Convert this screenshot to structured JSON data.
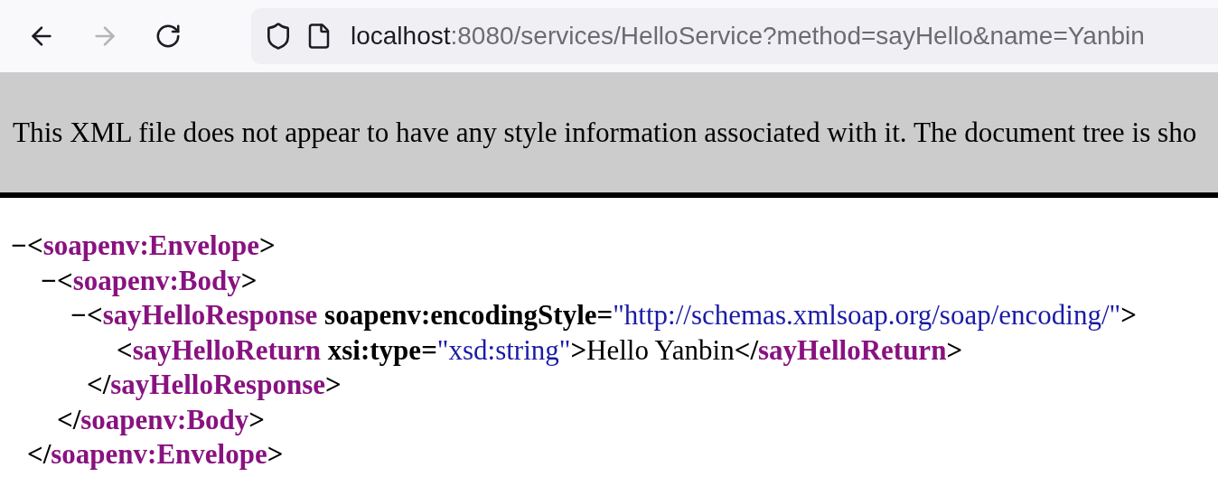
{
  "toolbar": {
    "back": {
      "disabled": false
    },
    "forward": {
      "disabled": true
    },
    "url": {
      "host": "localhost",
      "rest": ":8080/services/HelloService?method=sayHello&name=Yanbin"
    }
  },
  "banner": {
    "text": "This XML file does not appear to have any style information associated with it. The document tree is sho"
  },
  "xml_tree": [
    {
      "toggle": "−",
      "open": [
        {
          "kind": "punct",
          "text": "<"
        },
        {
          "kind": "tag",
          "text": "soapenv:Envelope"
        },
        {
          "kind": "punct",
          "text": ">"
        }
      ],
      "close": [
        {
          "kind": "punct",
          "text": "</"
        },
        {
          "kind": "tag",
          "text": "soapenv:Envelope"
        },
        {
          "kind": "punct",
          "text": ">"
        }
      ],
      "children": [
        {
          "toggle": "−",
          "open": [
            {
              "kind": "punct",
              "text": "<"
            },
            {
              "kind": "tag",
              "text": "soapenv:Body"
            },
            {
              "kind": "punct",
              "text": ">"
            }
          ],
          "close": [
            {
              "kind": "punct",
              "text": "</"
            },
            {
              "kind": "tag",
              "text": "soapenv:Body"
            },
            {
              "kind": "punct",
              "text": ">"
            }
          ],
          "children": [
            {
              "toggle": "−",
              "open": [
                {
                  "kind": "punct",
                  "text": "<"
                },
                {
                  "kind": "tag",
                  "text": "sayHelloResponse"
                },
                {
                  "kind": "attr",
                  "text": " soapenv:encodingStyle"
                },
                {
                  "kind": "punct",
                  "text": "="
                },
                {
                  "kind": "value",
                  "text": "\"http://schemas.xmlsoap.org/soap/encoding/\""
                },
                {
                  "kind": "punct",
                  "text": ">"
                }
              ],
              "close": [
                {
                  "kind": "punct",
                  "text": "</"
                },
                {
                  "kind": "tag",
                  "text": "sayHelloResponse"
                },
                {
                  "kind": "punct",
                  "text": ">"
                }
              ],
              "children": [
                {
                  "open": [
                    {
                      "kind": "punct",
                      "text": "<"
                    },
                    {
                      "kind": "tag",
                      "text": "sayHelloReturn"
                    },
                    {
                      "kind": "attr",
                      "text": " xsi:type"
                    },
                    {
                      "kind": "punct",
                      "text": "="
                    },
                    {
                      "kind": "value",
                      "text": "\"xsd:string\""
                    },
                    {
                      "kind": "punct",
                      "text": ">"
                    },
                    {
                      "kind": "text",
                      "text": "Hello Yanbin"
                    },
                    {
                      "kind": "punct",
                      "text": "</"
                    },
                    {
                      "kind": "tag",
                      "text": "sayHelloReturn"
                    },
                    {
                      "kind": "punct",
                      "text": ">"
                    }
                  ]
                }
              ]
            }
          ]
        }
      ]
    }
  ]
}
